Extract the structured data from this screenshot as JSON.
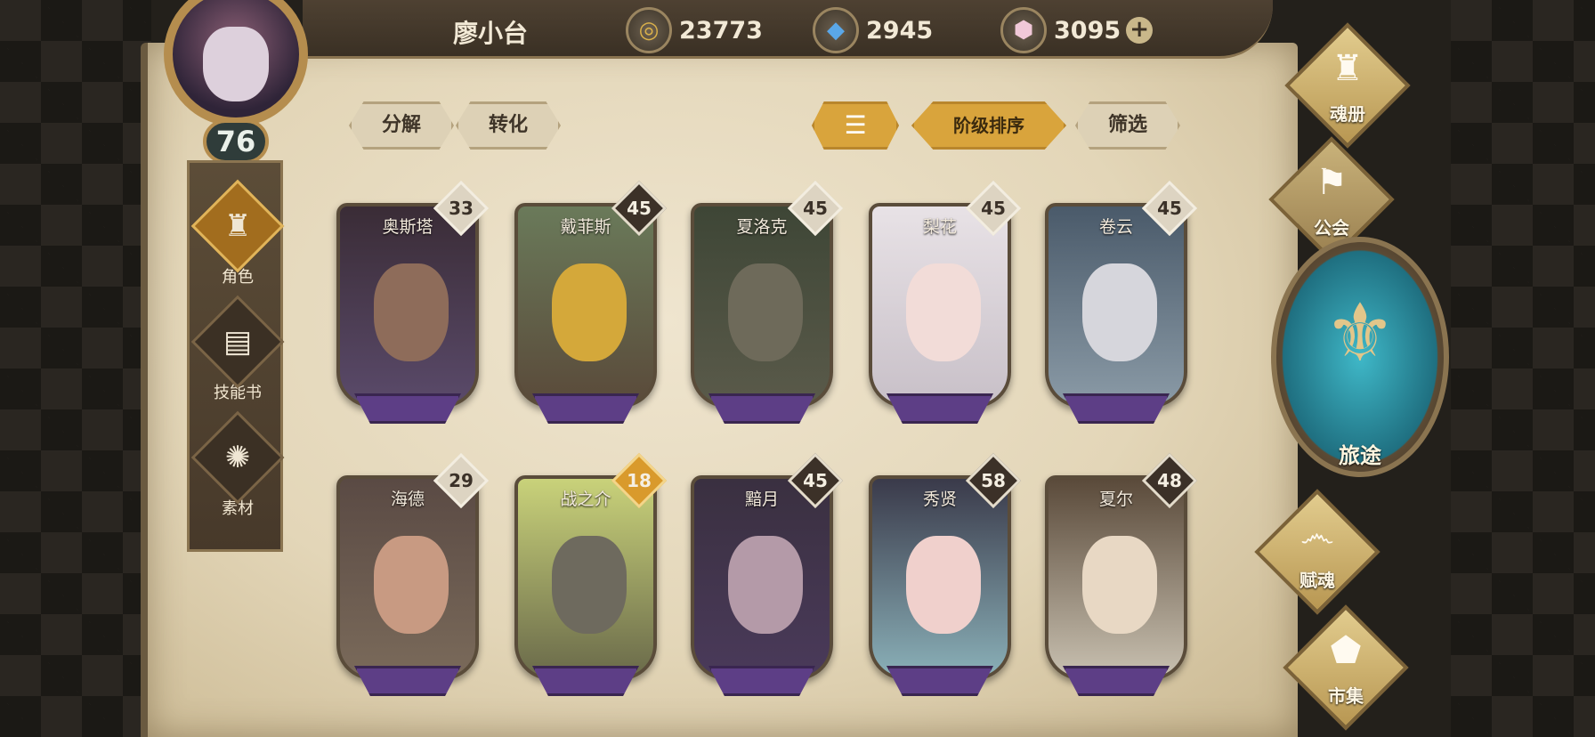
{
  "header": {
    "player_name": "廖小台",
    "level": "76",
    "currencies": {
      "gold": "23773",
      "crystal": "2945",
      "gem": "3095"
    }
  },
  "left_nav": {
    "items": [
      {
        "label": "角色"
      },
      {
        "label": "技能书"
      },
      {
        "label": "素材"
      }
    ]
  },
  "toolbar": {
    "decompose_label": "分解",
    "convert_label": "转化",
    "sort_label": "阶级排序",
    "filter_label": "筛选"
  },
  "characters": [
    {
      "name": "奥斯塔",
      "level": "33"
    },
    {
      "name": "戴菲斯",
      "level": "45"
    },
    {
      "name": "夏洛克",
      "level": "45"
    },
    {
      "name": "梨花",
      "level": "45"
    },
    {
      "name": "卷云",
      "level": "45"
    },
    {
      "name": "海德",
      "level": "29"
    },
    {
      "name": "战之介",
      "level": "18"
    },
    {
      "name": "黯月",
      "level": "45"
    },
    {
      "name": "秀贤",
      "level": "58"
    },
    {
      "name": "夏尔",
      "level": "48"
    }
  ],
  "right_nav": {
    "soul_book": "魂册",
    "guild": "公会",
    "journey": "旅途",
    "endow_soul": "赋魂",
    "market": "市集"
  },
  "colors": {
    "parchment": "#e3d6b8",
    "frame_dark": "#3a3024",
    "accent_gold": "#d9a43c",
    "journey_teal": "#3fb8c8"
  }
}
